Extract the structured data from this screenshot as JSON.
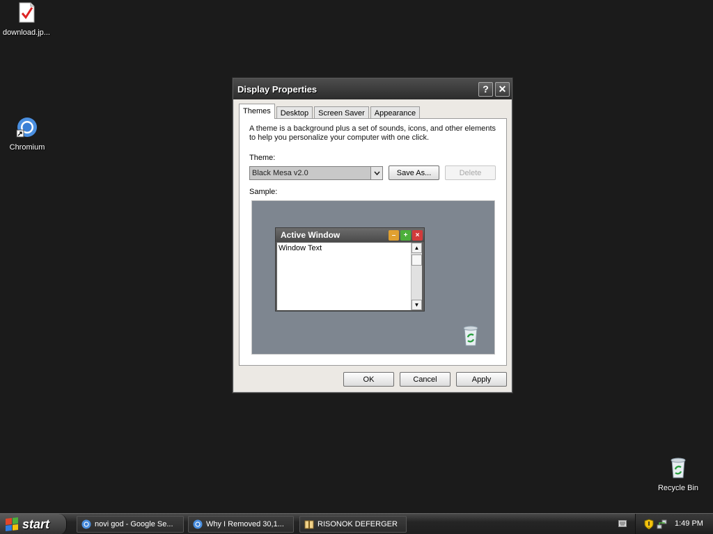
{
  "desktop": {
    "icons": [
      {
        "label": "download.jp..."
      },
      {
        "label": "Chromium"
      },
      {
        "label": "Recycle Bin"
      }
    ]
  },
  "dialog": {
    "title": "Display Properties",
    "help_glyph": "?",
    "close_glyph": "✕",
    "tabs": [
      {
        "label": "Themes"
      },
      {
        "label": "Desktop"
      },
      {
        "label": "Screen Saver"
      },
      {
        "label": "Appearance"
      }
    ],
    "active_tab": "Themes",
    "description": "A theme is a background plus a set of sounds, icons, and other elements to help you personalize your computer with one click.",
    "theme_label": "Theme:",
    "theme_value": "Black Mesa v2.0",
    "save_as_label": "Save As...",
    "delete_label": "Delete",
    "sample_label": "Sample:",
    "sample": {
      "window_title": "Active Window",
      "window_text": "Window Text"
    },
    "ok_label": "OK",
    "cancel_label": "Cancel",
    "apply_label": "Apply"
  },
  "taskbar": {
    "start_label": "start",
    "tasks": [
      {
        "label": "novi god - Google Se..."
      },
      {
        "label": "Why I Removed 30,1..."
      },
      {
        "label": "RISONOK DEFERGER"
      }
    ],
    "clock": "1:49 PM"
  },
  "colors": {
    "desktop": "#1b1b1b",
    "sample_bg": "#7e8690",
    "min_btn": "#e0a030",
    "max_btn": "#4caf3a",
    "close_btn": "#d23b3b"
  }
}
